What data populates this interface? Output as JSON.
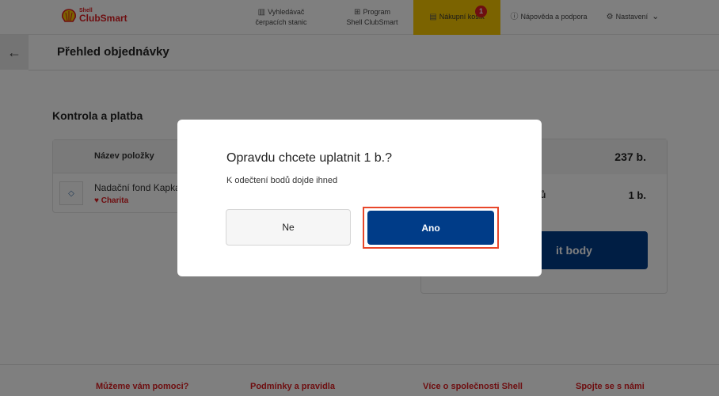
{
  "header": {
    "logo_small": "Shell",
    "logo_big": "ClubSmart",
    "nav": {
      "stations_line1": "Vyhledávač",
      "stations_line2": "čerpacích stanic",
      "program_line1": "Program",
      "program_line2": "Shell ClubSmart",
      "cart": "Nákupní košík",
      "cart_badge": "1",
      "help": "Nápověda a podpora",
      "settings": "Nastavení"
    }
  },
  "page": {
    "title": "Přehled objednávky",
    "section_title": "Kontrola a platba"
  },
  "table": {
    "column_name": "Název položky",
    "rows": [
      {
        "name": "Nadační fond Kapka",
        "category": "Charita"
      }
    ]
  },
  "summary": {
    "total": "237 b.",
    "label_partial": "ů",
    "cost": "1 b.",
    "pay_button_partial": "it body"
  },
  "footer": {
    "help": "Můžeme vám pomoci?",
    "terms": "Podmínky a pravidla",
    "about": "Více o společnosti Shell",
    "connect": "Spojte se s námi"
  },
  "modal": {
    "title": "Opravdu chcete uplatnit 1 b.?",
    "text": "K odečtení bodů dojde ihned",
    "no_label": "Ne",
    "yes_label": "Ano"
  },
  "colors": {
    "brand_red": "#dd1d21",
    "brand_yellow": "#f7c600",
    "primary_blue": "#003c88",
    "highlight_outline": "#e8472a"
  }
}
